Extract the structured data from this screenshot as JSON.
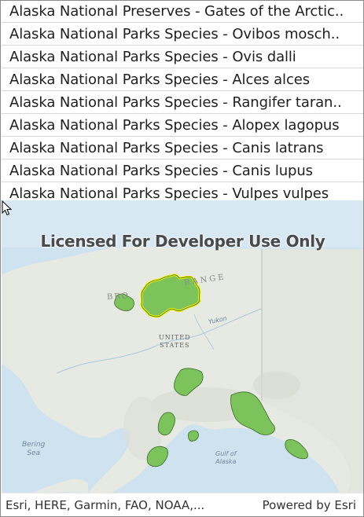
{
  "list": {
    "items": [
      {
        "label": "Alaska National Preserves - Gates of the Arctic.."
      },
      {
        "label": "Alaska National Parks Species - Ovibos mosch.."
      },
      {
        "label": "Alaska National Parks Species - Ovis dalli"
      },
      {
        "label": "Alaska National Parks Species - Alces alces"
      },
      {
        "label": "Alaska National Parks Species - Rangifer taran.."
      },
      {
        "label": "Alaska National Parks Species - Alopex lagopus"
      },
      {
        "label": "Alaska National Parks Species - Canis latrans"
      },
      {
        "label": "Alaska National Parks Species - Canis lupus"
      },
      {
        "label": "Alaska National Parks Species - Vulpes vulpes"
      }
    ]
  },
  "map": {
    "watermark": "Licensed For Developer Use Only",
    "labels": {
      "united_states_line1": "UNITED",
      "united_states_line2": "STATES",
      "range": "RANGE",
      "brooks": "BRO",
      "yukon": "Yukon",
      "bering_line1": "Bering",
      "bering_line2": "Sea",
      "gulf_line1": "Gulf of",
      "gulf_line2": "Alaska"
    },
    "colors": {
      "water": "#cfe2ef",
      "land": "#e6e9e2",
      "park_fill": "#7cc35b",
      "park_outline": "#3a6b2a",
      "selection": "#f2f200"
    }
  },
  "attribution": {
    "left": "Esri, HERE, Garmin, FAO, NOAA,...",
    "right": "Powered by Esri"
  }
}
